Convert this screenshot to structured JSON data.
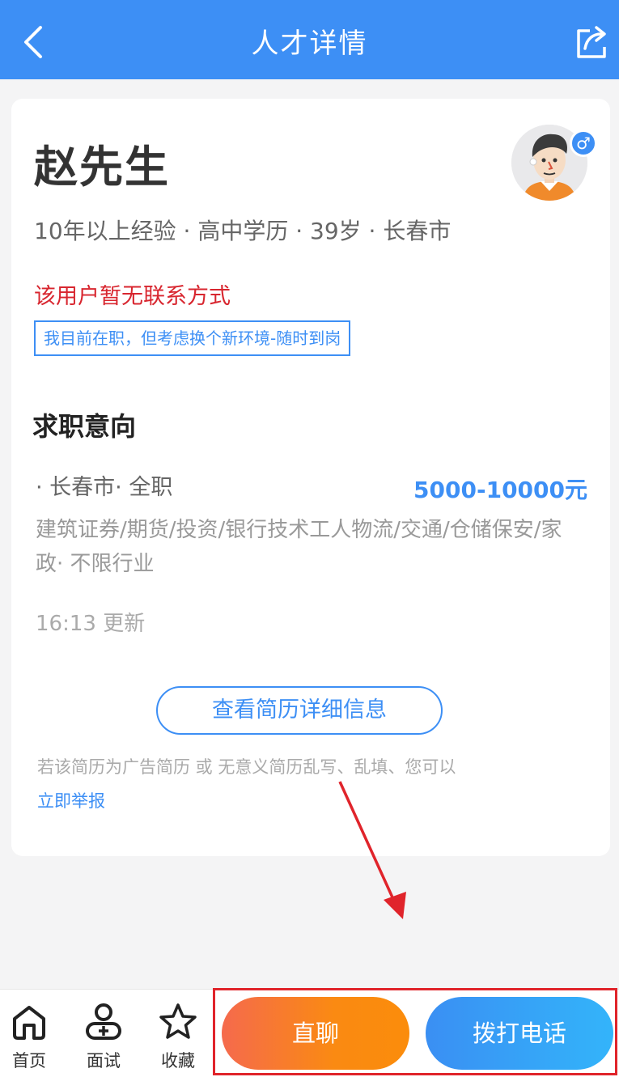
{
  "header": {
    "title": "人才详情",
    "back_icon": "chevron-left-icon",
    "share_icon": "share-icon"
  },
  "profile": {
    "name": "赵先生",
    "gender_symbol": "♂",
    "meta": "10年以上经验 · 高中学历 · 39岁 · 长春市",
    "no_contact": "该用户暂无联系方式",
    "status_tag": "我目前在职，但考虑换个新环境-随时到岗"
  },
  "intent": {
    "section_title": "求职意向",
    "location_type": "· 长春市· 全职",
    "salary": "5000-10000元",
    "industry": "建筑证券/期货/投资/银行技术工人物流/交通/仓储保安/家政· 不限行业",
    "updated": "16:13 更新"
  },
  "actions": {
    "view_resume": "查看简历详细信息",
    "report_note": "若该简历为广告简历 或 无意义简历乱写、乱填、您可以",
    "report_link": "立即举报"
  },
  "bottom_nav": [
    {
      "label": "首页",
      "icon": "home-icon"
    },
    {
      "label": "面试",
      "icon": "interview-icon"
    },
    {
      "label": "收藏",
      "icon": "star-icon"
    }
  ],
  "buttons": {
    "chat": "直聊",
    "call": "拨打电话"
  },
  "colors": {
    "primary": "#3d8ff5",
    "warning_text": "#d8262f",
    "chat_gradient_start": "#f56a4d",
    "chat_gradient_end": "#fb8c0b",
    "annotation": "#e0242b"
  }
}
